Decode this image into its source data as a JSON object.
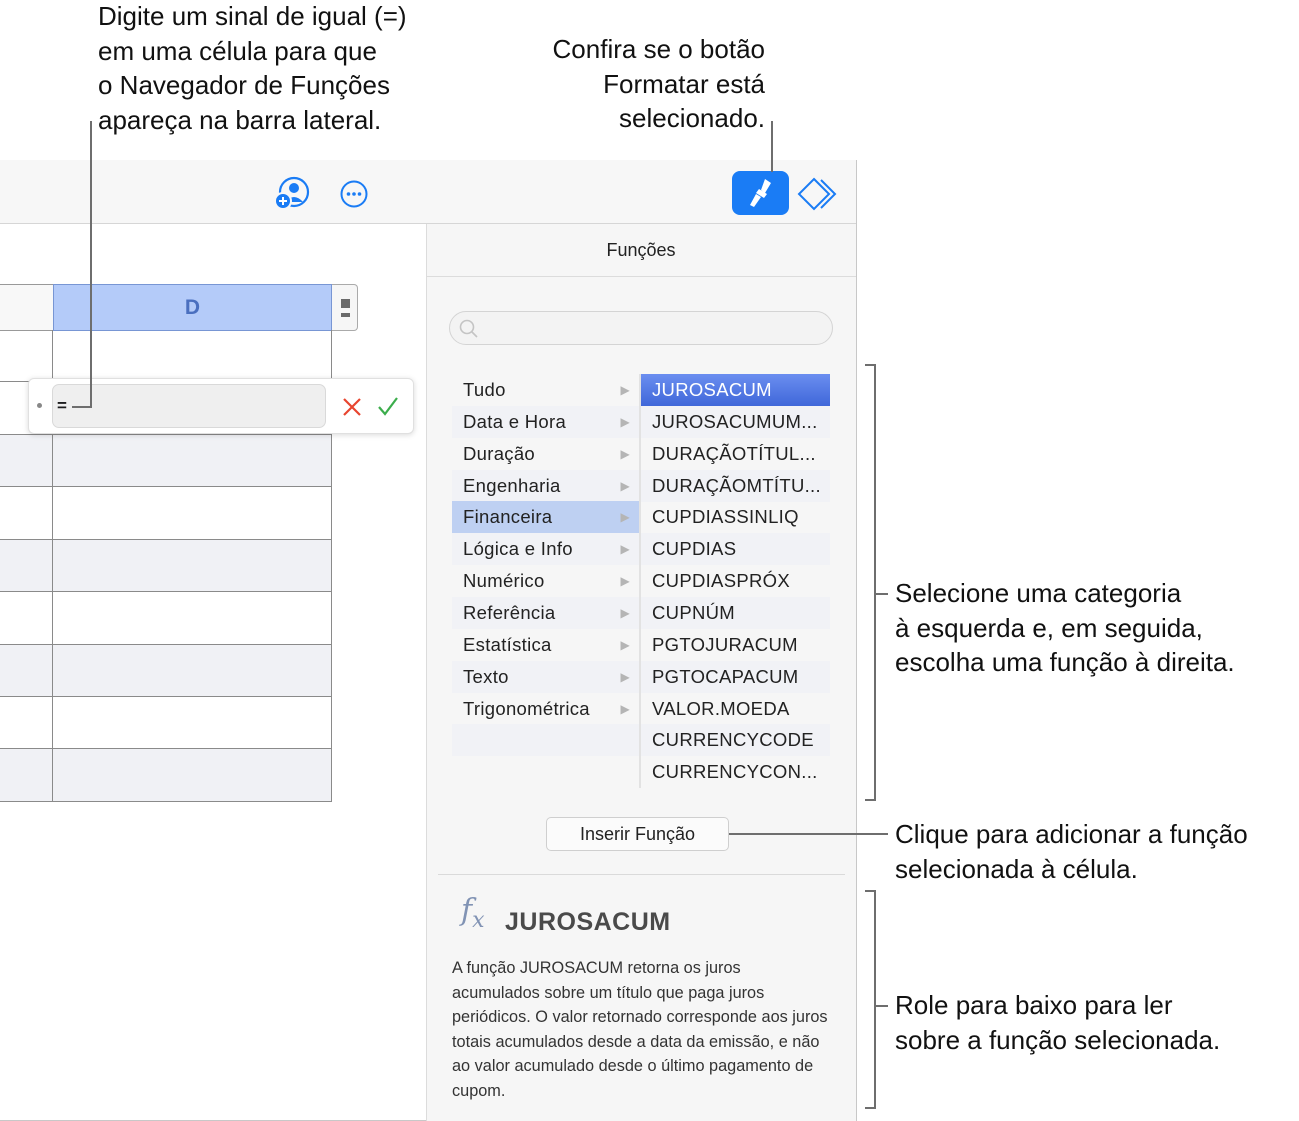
{
  "toolbar": {
    "collaborate_icon": "person-add-icon",
    "more_icon": "ellipsis-icon",
    "format_icon": "paintbrush-icon",
    "organize_icon": "diamond-icon",
    "accent": "#1a7cf5"
  },
  "sheet": {
    "column_label": "D",
    "formula_value": "=",
    "cancel_icon": "x-icon",
    "accept_icon": "checkmark-icon"
  },
  "sidebar": {
    "title": "Funções",
    "search_placeholder": "",
    "categories": [
      "Tudo",
      "Data e Hora",
      "Duração",
      "Engenharia",
      "Financeira",
      "Lógica e Info",
      "Numérico",
      "Referência",
      "Estatística",
      "Texto",
      "Trigonométrica"
    ],
    "selected_category": "Financeira",
    "functions": [
      "JUROSACUM",
      "JUROSACUMUM...",
      "DURAÇÃOTÍTUL...",
      "DURAÇÃOMTÍTU...",
      "CUPDIASSINLIQ",
      "CUPDIAS",
      "CUPDIASPRÓX",
      "CUPNÚM",
      "PGTOJURACUM",
      "PGTOCAPACUM",
      "VALOR.MOEDA",
      "CURRENCYCODE",
      "CURRENCYCON..."
    ],
    "selected_function": "JUROSACUM",
    "insert_button": "Inserir Função",
    "detail": {
      "icon": "fx-icon",
      "title": "JUROSACUM",
      "description": "A função JUROSACUM retorna os juros acumulados sobre um título que paga juros periódicos. O valor retornado corresponde aos juros totais acumulados desde a data da emissão, e não ao valor acumulado desde o último pagamento de cupom."
    }
  },
  "callouts": {
    "equal_sign": [
      "Digite um sinal de igual (=)",
      "em uma célula para que",
      "o Navegador de Funções",
      "apareça na barra lateral."
    ],
    "format_button": [
      "Confira se o botão",
      "Formatar está",
      "selecionado."
    ],
    "select_category": [
      "Selecione uma categoria",
      "à esquerda e, em seguida,",
      "escolha uma função à direita."
    ],
    "insert": [
      "Clique para adicionar a função",
      "selecionada à célula."
    ],
    "scroll": [
      "Role para baixo para ler",
      "sobre a função selecionada."
    ]
  }
}
